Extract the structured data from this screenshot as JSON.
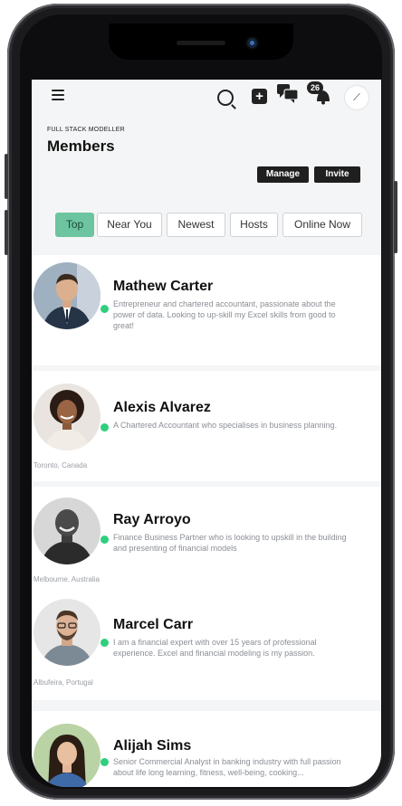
{
  "header": {
    "org": "FULL STACK MODELLER",
    "title": "Members",
    "notification_count": "26",
    "manage_label": "Manage",
    "invite_label": "Invite"
  },
  "tabs": [
    {
      "label": "Top",
      "active": true
    },
    {
      "label": "Near You",
      "active": false
    },
    {
      "label": "Newest",
      "active": false
    },
    {
      "label": "Hosts",
      "active": false
    },
    {
      "label": "Online Now",
      "active": false
    }
  ],
  "members": [
    {
      "name": "Mathew Carter",
      "bio": "Entrepreneur and chartered accountant, passionate about the power of data. Looking to up-skill my Excel skills from good to great!",
      "location": ""
    },
    {
      "name": "Alexis Alvarez",
      "bio": "A Chartered Accountant who specialises in business planning.",
      "location": "Toronto, Canada"
    },
    {
      "name": "Ray Arroyo",
      "bio": "Finance Business Partner who is looking to upskill in the building and presenting of financial models",
      "location": "Melbourne, Australia"
    },
    {
      "name": "Marcel Carr",
      "bio": "I am a financial expert with over 15 years of professional experience. Excel and financial modeling is my passion.",
      "location": "Albufeira, Portugal"
    },
    {
      "name": "Alijah Sims",
      "bio": "Senior Commercial Analyst in banking industry with full passion about life long learning, fitness, well-being, cooking...",
      "location": ""
    }
  ],
  "colors": {
    "accent": "#6cc5a0",
    "online": "#2fcf7d",
    "dark": "#1f1f1f"
  }
}
